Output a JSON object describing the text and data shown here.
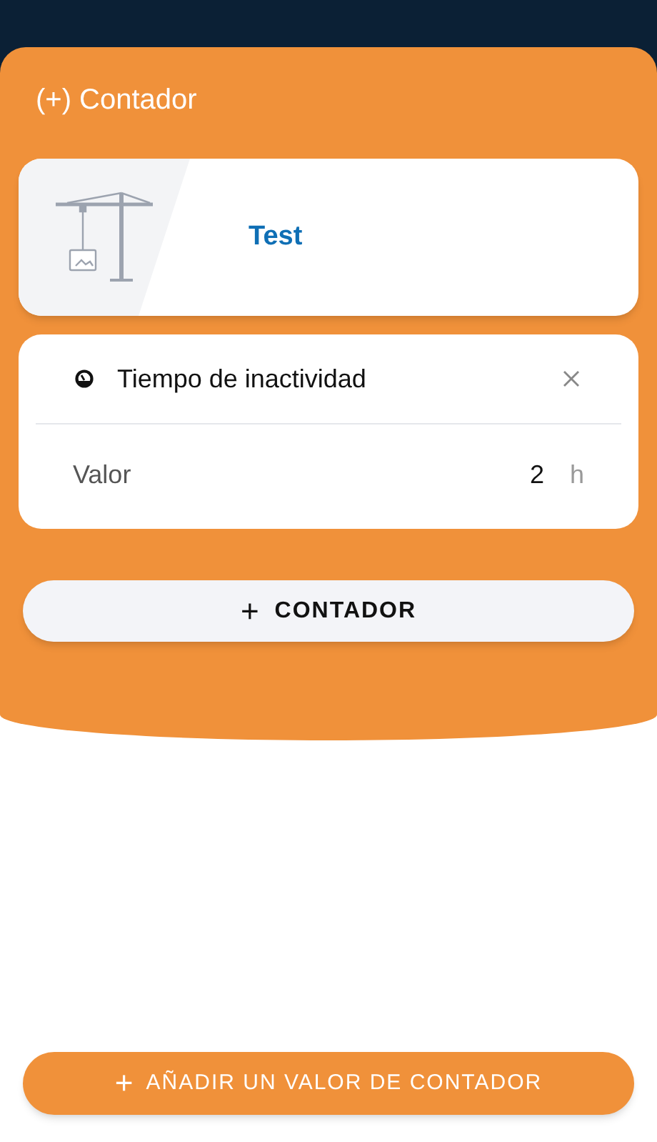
{
  "sheet": {
    "title": "(+) Contador"
  },
  "asset": {
    "name": "Test"
  },
  "counters": [
    {
      "name": "Tiempo de inactividad",
      "value_label": "Valor",
      "value": "2",
      "unit": "h"
    }
  ],
  "add_counter_button": {
    "icon": "+",
    "label": "CONTADOR"
  },
  "add_value_button": {
    "icon": "+",
    "label": "AÑADIR UN VALOR DE CONTADOR"
  }
}
